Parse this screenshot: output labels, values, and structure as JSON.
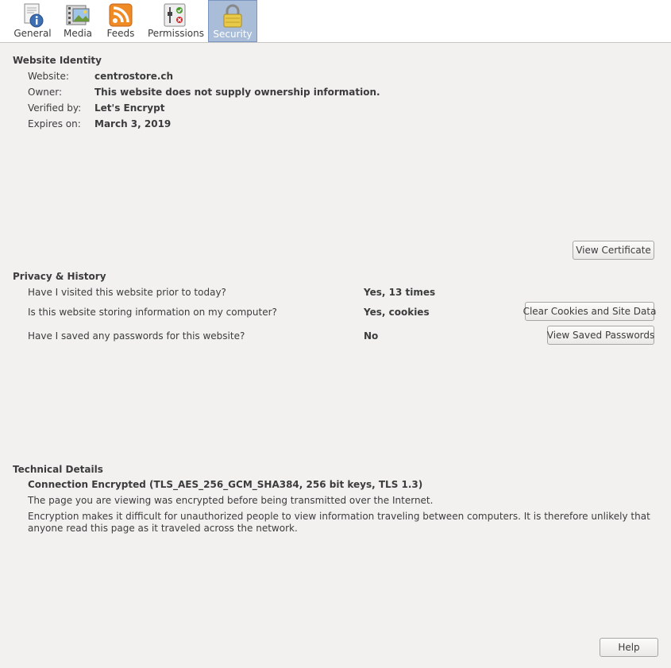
{
  "tabs": [
    {
      "label": "General",
      "mnemonic": "G",
      "icon": "info-document-icon"
    },
    {
      "label": "Media",
      "mnemonic": "M",
      "icon": "media-film-icon"
    },
    {
      "label": "Feeds",
      "mnemonic": "F",
      "icon": "rss-feed-icon"
    },
    {
      "label": "Permissions",
      "mnemonic": "P",
      "icon": "permissions-switch-icon"
    },
    {
      "label": "Security",
      "mnemonic": "S",
      "icon": "padlock-icon",
      "active": true
    }
  ],
  "identity": {
    "title": "Website Identity",
    "website_label": "Website:",
    "website_value": "centrostore.ch",
    "owner_label": "Owner:",
    "owner_value": "This website does not supply ownership information.",
    "verified_label": "Verified by:",
    "verified_value": "Let's Encrypt",
    "expires_label": "Expires on:",
    "expires_value": "March 3, 2019",
    "view_certificate": "View Certificate"
  },
  "privacy": {
    "title": "Privacy & History",
    "visited_q": "Have I visited this website prior to today?",
    "visited_a": "Yes, 13 times",
    "storing_q": "Is this website storing information on my computer?",
    "storing_a": "Yes, cookies",
    "clear_button": "Clear Cookies and Site Data",
    "passwords_q": "Have I saved any passwords for this website?",
    "passwords_a": "No",
    "view_passwords_button": "View Saved Passwords"
  },
  "technical": {
    "title": "Technical Details",
    "connection": "Connection Encrypted (TLS_AES_256_GCM_SHA384, 256 bit keys, TLS 1.3)",
    "para1": "The page you are viewing was encrypted before being transmitted over the Internet.",
    "para2": "Encryption makes it difficult for unauthorized people to view information traveling between computers. It is therefore unlikely that anyone read this page as it traveled across the network."
  },
  "footer": {
    "help_button": "Help"
  },
  "colors": {
    "active_tab": "#a9bdd9",
    "rss_orange": "#f08a24",
    "background": "#f2f1f0"
  }
}
